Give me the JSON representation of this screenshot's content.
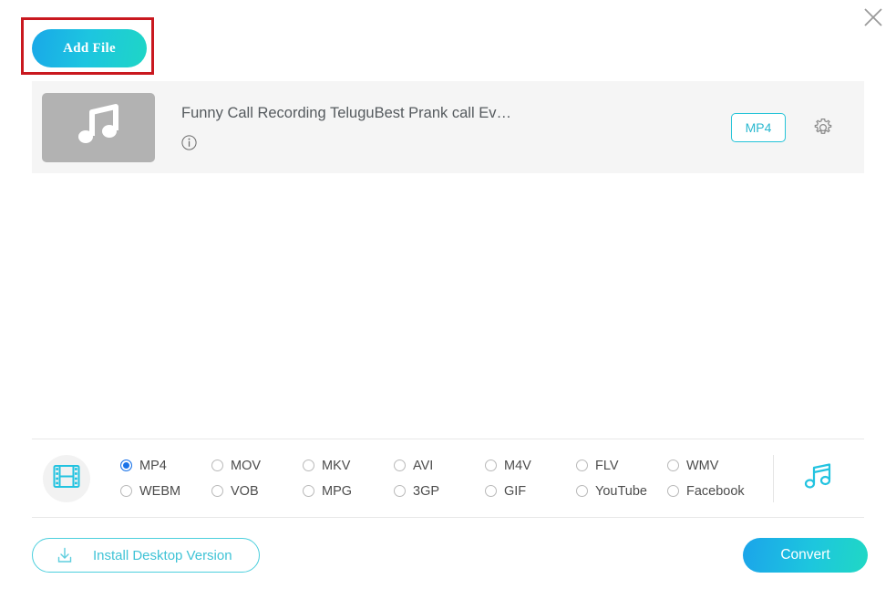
{
  "window": {
    "close_icon": "close-icon"
  },
  "toolbar": {
    "add_file_label": "Add File",
    "add_file_icon": "add-file-button",
    "highlight_color": "#c9181f",
    "accent_gradient_from": "#19a8e8",
    "accent_gradient_to": "#1ed6c6"
  },
  "file_list": [
    {
      "thumbnail_icon": "music-note-icon",
      "title": "Funny Call Recording TeluguBest Prank call Ev…",
      "info_icon": "info-icon",
      "format_badge": "MP4",
      "settings_icon": "gear-icon"
    }
  ],
  "format_bar": {
    "media_type_icon": "film-strip-icon",
    "audio_tab_icon": "music-note-icon",
    "selected_format": "MP4",
    "options": [
      {
        "label": "MP4",
        "selected": true
      },
      {
        "label": "MOV",
        "selected": false
      },
      {
        "label": "MKV",
        "selected": false
      },
      {
        "label": "AVI",
        "selected": false
      },
      {
        "label": "M4V",
        "selected": false
      },
      {
        "label": "FLV",
        "selected": false
      },
      {
        "label": "WMV",
        "selected": false
      },
      {
        "label": "WEBM",
        "selected": false
      },
      {
        "label": "VOB",
        "selected": false
      },
      {
        "label": "MPG",
        "selected": false
      },
      {
        "label": "3GP",
        "selected": false
      },
      {
        "label": "GIF",
        "selected": false
      },
      {
        "label": "YouTube",
        "selected": false
      },
      {
        "label": "Facebook",
        "selected": false
      }
    ]
  },
  "footer": {
    "install_label": "Install Desktop Version",
    "install_icon": "download-icon",
    "convert_label": "Convert"
  }
}
